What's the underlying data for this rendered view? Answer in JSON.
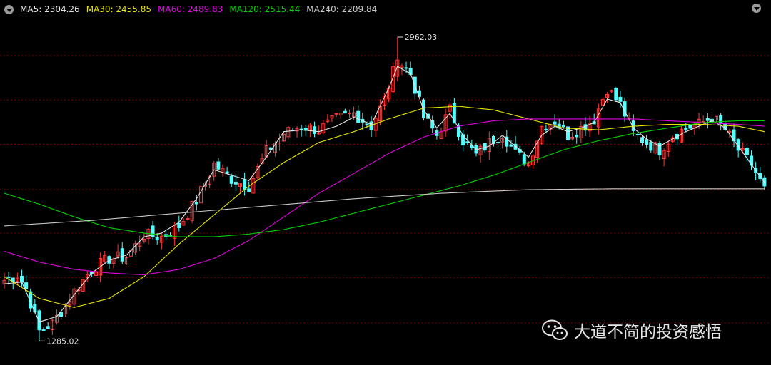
{
  "legend": {
    "items": [
      {
        "label": "MA5: 2304.26",
        "color": "#e6e6e6"
      },
      {
        "label": "MA30: 2455.85",
        "color": "#e6e600"
      },
      {
        "label": "MA60: 2489.83",
        "color": "#e000e0"
      },
      {
        "label": "MA120: 2515.44",
        "color": "#00d000"
      },
      {
        "label": "MA240: 2209.84",
        "color": "#c8c8c8"
      }
    ]
  },
  "annotations": {
    "high_label": "2962.03",
    "low_label": "1285.02"
  },
  "watermark": {
    "text": "大道不简的投资感悟",
    "icon": "wechat-icon"
  },
  "colors": {
    "background": "#000000",
    "up": "#ff3b3b",
    "down": "#54ffff",
    "grid": "#7a0000"
  },
  "chart_data": {
    "type": "candlestick",
    "ylim": [
      1180,
      3080
    ],
    "grid_levels": [
      1385,
      1635,
      1880,
      2120,
      2370,
      2615,
      2860
    ],
    "high": {
      "index": 90,
      "value": 2962.03
    },
    "low": {
      "index": 8,
      "value": 1285.02
    },
    "anchors": [
      [
        0,
        1620
      ],
      [
        3,
        1650
      ],
      [
        5,
        1575
      ],
      [
        8,
        1340
      ],
      [
        11,
        1380
      ],
      [
        13,
        1450
      ],
      [
        16,
        1560
      ],
      [
        20,
        1680
      ],
      [
        24,
        1740
      ],
      [
        28,
        1750
      ],
      [
        32,
        1870
      ],
      [
        36,
        1860
      ],
      [
        40,
        1920
      ],
      [
        44,
        2060
      ],
      [
        48,
        2260
      ],
      [
        52,
        2180
      ],
      [
        56,
        2140
      ],
      [
        60,
        2330
      ],
      [
        64,
        2430
      ],
      [
        68,
        2470
      ],
      [
        72,
        2450
      ],
      [
        76,
        2510
      ],
      [
        80,
        2540
      ],
      [
        84,
        2470
      ],
      [
        87,
        2620
      ],
      [
        90,
        2840
      ],
      [
        93,
        2760
      ],
      [
        96,
        2520
      ],
      [
        99,
        2420
      ],
      [
        102,
        2560
      ],
      [
        105,
        2390
      ],
      [
        108,
        2310
      ],
      [
        111,
        2380
      ],
      [
        114,
        2430
      ],
      [
        117,
        2320
      ],
      [
        120,
        2270
      ],
      [
        123,
        2470
      ],
      [
        126,
        2500
      ],
      [
        129,
        2420
      ],
      [
        132,
        2460
      ],
      [
        135,
        2510
      ],
      [
        138,
        2680
      ],
      [
        141,
        2590
      ],
      [
        144,
        2430
      ],
      [
        147,
        2380
      ],
      [
        150,
        2340
      ],
      [
        153,
        2420
      ],
      [
        156,
        2460
      ],
      [
        159,
        2480
      ],
      [
        162,
        2520
      ],
      [
        165,
        2450
      ],
      [
        168,
        2340
      ],
      [
        171,
        2260
      ],
      [
        174,
        2120
      ]
    ],
    "ma": [
      {
        "name": "MA5",
        "color": "#e6e6e6",
        "values": [
          [
            0,
            1600
          ],
          [
            4,
            1610
          ],
          [
            8,
            1390
          ],
          [
            12,
            1420
          ],
          [
            16,
            1540
          ],
          [
            20,
            1660
          ],
          [
            24,
            1730
          ],
          [
            28,
            1760
          ],
          [
            32,
            1860
          ],
          [
            36,
            1880
          ],
          [
            40,
            1940
          ],
          [
            44,
            2070
          ],
          [
            48,
            2230
          ],
          [
            52,
            2200
          ],
          [
            56,
            2170
          ],
          [
            60,
            2300
          ],
          [
            64,
            2440
          ],
          [
            68,
            2450
          ],
          [
            72,
            2440
          ],
          [
            76,
            2470
          ],
          [
            80,
            2520
          ],
          [
            84,
            2480
          ],
          [
            88,
            2680
          ],
          [
            90,
            2800
          ],
          [
            93,
            2760
          ],
          [
            96,
            2560
          ],
          [
            99,
            2460
          ],
          [
            102,
            2540
          ],
          [
            105,
            2420
          ],
          [
            108,
            2340
          ],
          [
            111,
            2360
          ],
          [
            114,
            2420
          ],
          [
            117,
            2360
          ],
          [
            120,
            2300
          ],
          [
            123,
            2420
          ],
          [
            126,
            2470
          ],
          [
            129,
            2440
          ],
          [
            132,
            2460
          ],
          [
            135,
            2490
          ],
          [
            138,
            2620
          ],
          [
            141,
            2600
          ],
          [
            144,
            2460
          ],
          [
            147,
            2400
          ],
          [
            150,
            2360
          ],
          [
            153,
            2400
          ],
          [
            156,
            2440
          ],
          [
            159,
            2470
          ],
          [
            162,
            2500
          ],
          [
            165,
            2460
          ],
          [
            168,
            2360
          ],
          [
            171,
            2260
          ],
          [
            174,
            2160
          ]
        ]
      },
      {
        "name": "MA30",
        "color": "#e6e600",
        "values": [
          [
            0,
            1640
          ],
          [
            8,
            1520
          ],
          [
            16,
            1470
          ],
          [
            24,
            1520
          ],
          [
            32,
            1640
          ],
          [
            40,
            1820
          ],
          [
            48,
            1980
          ],
          [
            56,
            2140
          ],
          [
            64,
            2270
          ],
          [
            72,
            2380
          ],
          [
            80,
            2440
          ],
          [
            88,
            2510
          ],
          [
            96,
            2570
          ],
          [
            104,
            2580
          ],
          [
            112,
            2560
          ],
          [
            120,
            2510
          ],
          [
            128,
            2460
          ],
          [
            136,
            2450
          ],
          [
            144,
            2470
          ],
          [
            152,
            2480
          ],
          [
            160,
            2480
          ],
          [
            168,
            2470
          ],
          [
            174,
            2440
          ]
        ]
      },
      {
        "name": "MA60",
        "color": "#e000e0",
        "values": [
          [
            0,
            1780
          ],
          [
            8,
            1720
          ],
          [
            16,
            1680
          ],
          [
            24,
            1660
          ],
          [
            32,
            1650
          ],
          [
            40,
            1680
          ],
          [
            48,
            1740
          ],
          [
            56,
            1840
          ],
          [
            64,
            1970
          ],
          [
            72,
            2100
          ],
          [
            80,
            2210
          ],
          [
            88,
            2320
          ],
          [
            96,
            2410
          ],
          [
            104,
            2470
          ],
          [
            112,
            2500
          ],
          [
            120,
            2510
          ],
          [
            128,
            2510
          ],
          [
            136,
            2510
          ],
          [
            144,
            2510
          ],
          [
            152,
            2500
          ],
          [
            160,
            2490
          ],
          [
            168,
            2480
          ],
          [
            174,
            2470
          ]
        ]
      },
      {
        "name": "MA120",
        "color": "#00d000",
        "values": [
          [
            0,
            2100
          ],
          [
            8,
            2040
          ],
          [
            16,
            1970
          ],
          [
            24,
            1910
          ],
          [
            32,
            1880
          ],
          [
            40,
            1860
          ],
          [
            48,
            1860
          ],
          [
            56,
            1875
          ],
          [
            64,
            1900
          ],
          [
            72,
            1940
          ],
          [
            80,
            1990
          ],
          [
            88,
            2040
          ],
          [
            96,
            2090
          ],
          [
            104,
            2140
          ],
          [
            112,
            2200
          ],
          [
            120,
            2270
          ],
          [
            128,
            2340
          ],
          [
            136,
            2390
          ],
          [
            144,
            2430
          ],
          [
            152,
            2460
          ],
          [
            160,
            2490
          ],
          [
            168,
            2500
          ],
          [
            174,
            2500
          ]
        ]
      },
      {
        "name": "MA240",
        "color": "#c8c8c8",
        "values": [
          [
            0,
            1920
          ],
          [
            20,
            1950
          ],
          [
            40,
            1990
          ],
          [
            60,
            2030
          ],
          [
            80,
            2070
          ],
          [
            100,
            2100
          ],
          [
            120,
            2120
          ],
          [
            140,
            2125
          ],
          [
            160,
            2125
          ],
          [
            174,
            2125
          ]
        ]
      }
    ]
  }
}
